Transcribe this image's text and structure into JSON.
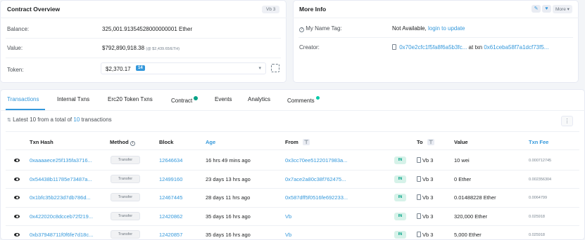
{
  "overview": {
    "title": "Contract Overview",
    "badge": "Vb 3",
    "balance_label": "Balance:",
    "balance_value": "325,001.91354528000000001 Ether",
    "value_label": "Value:",
    "value_value": "$792,890,918.38",
    "value_rate": "(@ $2,439.65/ETH)",
    "token_label": "Token:",
    "token_value": "$2,370.17",
    "token_count": "14"
  },
  "more_info": {
    "title": "More Info",
    "more_label": "More",
    "name_tag_label": "My Name Tag:",
    "name_tag_value": "Not Available,",
    "name_tag_link": "login to update",
    "creator_label": "Creator:",
    "creator_address": "0x70e2cfc1f5fa8f6a5b3fc...",
    "creator_at": "at txn",
    "creator_txn": "0x61ceba58f7a1dcf73f5..."
  },
  "tabs": [
    "Transactions",
    "Internal Txns",
    "Erc20 Token Txns",
    "Contract",
    "Events",
    "Analytics",
    "Comments"
  ],
  "summary": {
    "prefix": "Latest 10 from a total of",
    "count": "10",
    "suffix": "transactions"
  },
  "table": {
    "headers": {
      "hash": "Txn Hash",
      "method": "Method",
      "block": "Block",
      "age": "Age",
      "from": "From",
      "to": "To",
      "value": "Value",
      "fee": "Txn Fee"
    },
    "rows": [
      {
        "hash": "0xaaaaece25f135fa3716...",
        "method": "Transfer",
        "block": "12646634",
        "age": "16 hrs 49 mins ago",
        "from": "0x3cc70ee5122017983a...",
        "dir": "IN",
        "to": "Vb 3",
        "value": "10 wei",
        "fee": "0.000712745"
      },
      {
        "hash": "0x54438b11785e73487a...",
        "method": "Transfer",
        "block": "12499160",
        "age": "23 days 13 hrs ago",
        "from": "0x7ace2a80c38f762475...",
        "dir": "IN",
        "to": "Vb 3",
        "value": "0 Ether",
        "fee": "0.002356304"
      },
      {
        "hash": "0x1bfc35b223d7db786d...",
        "method": "Transfer",
        "block": "12467445",
        "age": "28 days 11 hrs ago",
        "from": "0x587dff5f0516fe692233...",
        "dir": "IN",
        "to": "Vb 3",
        "value": "0.01488228 Ether",
        "fee": "0.0064799"
      },
      {
        "hash": "0x422020c8dcceb72f219...",
        "method": "Transfer",
        "block": "12420862",
        "age": "35 days 16 hrs ago",
        "from": "Vb",
        "dir": "IN",
        "to": "Vb 3",
        "value": "320,000 Ether",
        "fee": "0.025918"
      },
      {
        "hash": "0xb37948711f0f6fe7d18c...",
        "method": "Transfer",
        "block": "12420857",
        "age": "35 days 16 hrs ago",
        "from": "Vb",
        "dir": "IN",
        "to": "Vb 3",
        "value": "5,000 Ether",
        "fee": "0.025918"
      }
    ]
  },
  "colors": {
    "accent": "#3498db",
    "in_badge_bg": "#d6f2e9",
    "in_badge_text": "#00a186"
  }
}
